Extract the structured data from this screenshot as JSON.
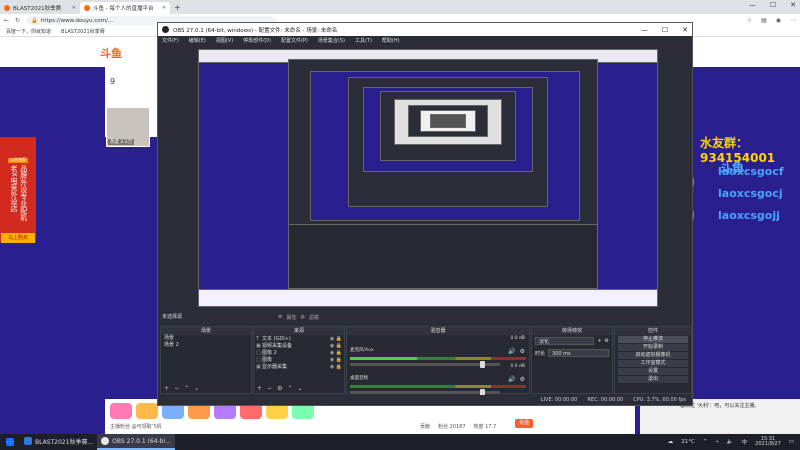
{
  "browser": {
    "tabs": [
      {
        "label": "BLAST2021秋季赛",
        "active": false
      },
      {
        "label": "斗鱼 - 每个人的直播平台",
        "active": true
      }
    ],
    "new_tab": "+",
    "address": "https://www.douyu.com/...",
    "bookmarks": [
      "百度一下，你就知道",
      "BLAST2021秋季赛"
    ]
  },
  "page": {
    "logo": "斗鱼",
    "follow_count": "9",
    "avatar_label": "热度 2.2万",
    "left_ad_tag": "斗鱼独家",
    "left_ad_col1": "老X电竞外设店",
    "left_ad_col2": "品牌外设专业配机",
    "left_ad_button": "马上购买",
    "chat_gold": "水友群：934154001",
    "chat_blue": [
      "laoxcsgocf",
      "laoxcsgocj",
      "laoxcsgojj"
    ],
    "right_logo": "斗鱼",
    "bottom_left": "主播粉丝 @可领取飞机",
    "bottom_stats": [
      "贡献",
      "粉丝 20187",
      "热度 17.7"
    ],
    "bottom_btn": "充值",
    "bottom_right": "@颗粒 '大利'：吧，可以关注主播。"
  },
  "obs": {
    "title": "OBS 27.0.1 (64-bit, windows) - 配置文件: 未命名 - 场景: 未命名",
    "menu": [
      "文件(F)",
      "编辑(E)",
      "视图(V)",
      "停靠部件(D)",
      "配置文件(P)",
      "场景集合(S)",
      "工具(T)",
      "帮助(H)"
    ],
    "scene_label": "未选择源",
    "preview_ctrl": [
      "属性",
      "滤镜"
    ],
    "scenes": {
      "title": "场景",
      "items": [
        "场景",
        "场景 2"
      ],
      "selected": 0
    },
    "sources": {
      "title": "来源",
      "items": [
        {
          "icon": "T",
          "label": "文本 (GDI+)"
        },
        {
          "icon": "▣",
          "label": "视频采集设备"
        },
        {
          "icon": "▢",
          "label": "图像 2"
        },
        {
          "icon": "▢",
          "label": "图像"
        },
        {
          "icon": "▣",
          "label": "显示器采集"
        }
      ]
    },
    "mixer": {
      "title": "混音器",
      "channels": [
        {
          "name": "麦克风/Aux",
          "db": "0.0 dB",
          "live": true,
          "level": 0.88
        },
        {
          "name": "桌面音频",
          "db": "0.0 dB",
          "live": false,
          "level": 0.88
        }
      ]
    },
    "transitions": {
      "title": "转场特效",
      "type": "淡化",
      "duration_label": "时长",
      "duration": "300 ms"
    },
    "controls": {
      "title": "控件",
      "buttons": [
        "停止推流",
        "开始录制",
        "启动虚拟摄像机",
        "工作室模式",
        "设置",
        "退出"
      ]
    },
    "status": [
      "LIVE: 00:00:00",
      "REC: 00:00:00",
      "CPU: 3.7%, 60.00 fps"
    ]
  },
  "taskbar": {
    "apps": [
      {
        "label": "BLAST2021秋季赛...",
        "color": "#2d7be0",
        "active": false
      },
      {
        "label": "OBS 27.0.1 (64-bi...",
        "color": "#e8e8e8",
        "active": true
      }
    ],
    "weather": "21°C",
    "time": "15:31",
    "date": "2021/9/27"
  },
  "colors": {
    "obs_bg": "#2b2e38",
    "page_bg": "#2a1f8f",
    "chat_gold": "#ffd400",
    "chat_blue": "#4aa3ff",
    "brand": "#ff5d23"
  }
}
